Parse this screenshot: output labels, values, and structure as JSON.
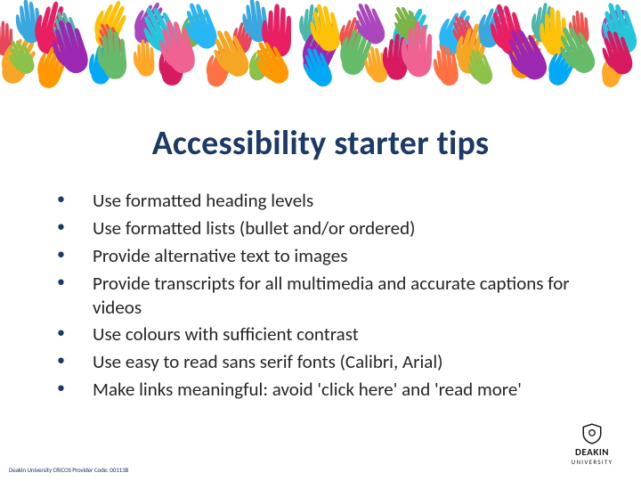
{
  "title": "Accessibility starter tips",
  "bullets": [
    "Use formatted heading levels",
    "Use formatted lists (bullet and/or ordered)",
    "Provide alternative text to images",
    "Provide transcripts for all multimedia and accurate captions for videos",
    "Use colours with sufficient contrast",
    "Use easy to read sans serif fonts (Calibri, Arial)",
    "Make links meaningful: avoid 'click here' and 'read more'"
  ],
  "footer": "Deakin University CRICOS Provider Code: 00113B",
  "logo": {
    "name": "DEAKIN",
    "sub": "UNIVERSITY"
  },
  "banner_colors": [
    "#e8465b",
    "#f5a623",
    "#3aa8e0",
    "#8bc34a",
    "#e91e63",
    "#ff9800",
    "#4db6ac",
    "#9c27b0",
    "#ffc107",
    "#03a9f4",
    "#ef5350",
    "#66bb6a",
    "#ab47bc",
    "#ffa726",
    "#26c6da",
    "#d81b60",
    "#7cb342",
    "#f06292",
    "#29b6f6",
    "#ff7043"
  ]
}
